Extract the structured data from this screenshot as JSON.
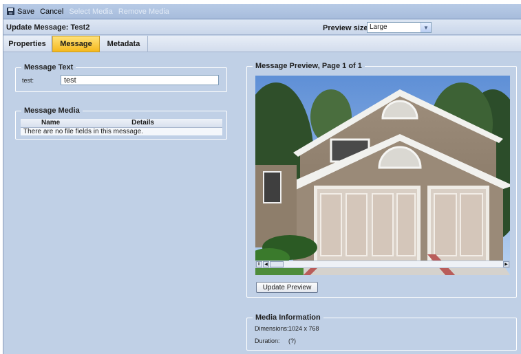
{
  "toolbar": {
    "save_label": "Save",
    "cancel_label": "Cancel",
    "select_media_label": "Select Media",
    "remove_media_label": "Remove Media"
  },
  "header": {
    "title": "Update Message: Test2",
    "preview_size_label": "Preview size:",
    "preview_size_value": "Large"
  },
  "tabs": [
    {
      "label": "Properties"
    },
    {
      "label": "Message"
    },
    {
      "label": "Metadata"
    }
  ],
  "message_text": {
    "legend": "Message Text",
    "field_label": "test:",
    "field_value": "test"
  },
  "message_media": {
    "legend": "Message Media",
    "columns": [
      "Name",
      "Details"
    ],
    "empty_text": "There are no file fields in this message."
  },
  "preview": {
    "legend": "Message Preview, Page 1 of 1",
    "update_button": "Update Preview"
  },
  "media_info": {
    "legend": "Media Information",
    "dimensions_label": "Dimensions:",
    "dimensions_value": "1024 x 768",
    "duration_label": "Duration:",
    "duration_value": "(?)"
  },
  "colors": {
    "background": "#c0d0e6",
    "active_tab": "#f5b81c"
  }
}
